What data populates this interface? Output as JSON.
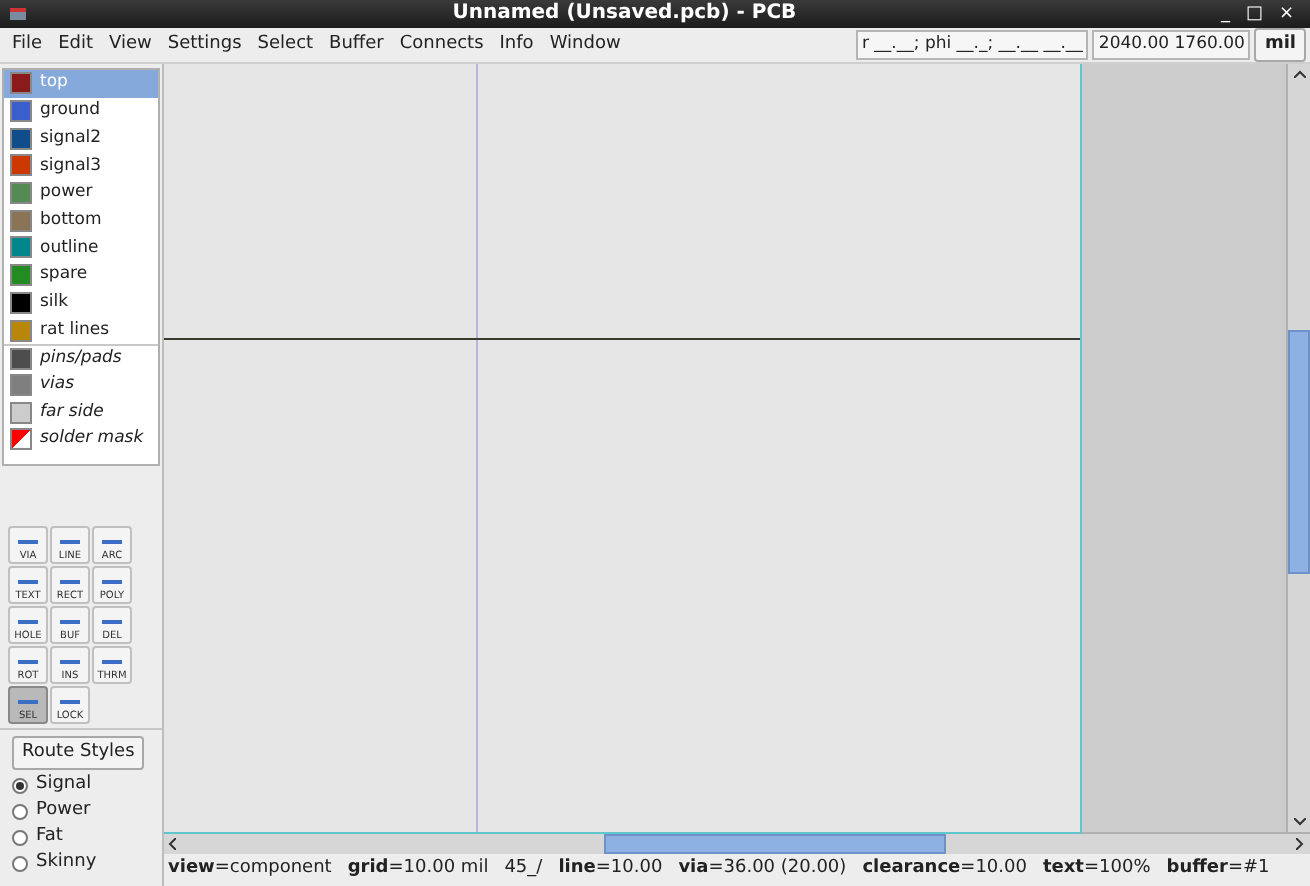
{
  "window": {
    "title": "Unnamed (Unsaved.pcb) - PCB",
    "controls": [
      "_",
      "□",
      "×"
    ]
  },
  "menu": [
    "File",
    "Edit",
    "View",
    "Settings",
    "Select",
    "Buffer",
    "Connects",
    "Info",
    "Window"
  ],
  "coords": {
    "polar": "r __.__; phi __._; __.__ __.__",
    "position": "2040.00 1760.00",
    "unit": "mil"
  },
  "layers": [
    {
      "name": "top",
      "color": "#8b1a1a",
      "selected": true,
      "kind": "layer"
    },
    {
      "name": "ground",
      "color": "#3a5fcd",
      "selected": false,
      "kind": "layer"
    },
    {
      "name": "signal2",
      "color": "#104e8b",
      "selected": false,
      "kind": "layer"
    },
    {
      "name": "signal3",
      "color": "#cd3700",
      "selected": false,
      "kind": "layer"
    },
    {
      "name": "power",
      "color": "#548b54",
      "selected": false,
      "kind": "layer"
    },
    {
      "name": "bottom",
      "color": "#8b7355",
      "selected": false,
      "kind": "layer"
    },
    {
      "name": "outline",
      "color": "#00868b",
      "selected": false,
      "kind": "layer"
    },
    {
      "name": "spare",
      "color": "#228b22",
      "selected": false,
      "kind": "layer"
    },
    {
      "name": "silk",
      "color": "#000000",
      "selected": false,
      "kind": "layer"
    },
    {
      "name": "rat lines",
      "color": "#b8860b",
      "selected": false,
      "kind": "layer"
    },
    {
      "name": "pins/pads",
      "color": "#4d4d4d",
      "selected": false,
      "kind": "virtual"
    },
    {
      "name": "vias",
      "color": "#7f7f7f",
      "selected": false,
      "kind": "virtual"
    },
    {
      "name": "far side",
      "color": "#cccccc",
      "selected": false,
      "kind": "virtual"
    },
    {
      "name": "solder mask",
      "color": "#ff0000",
      "selected": false,
      "kind": "mask"
    }
  ],
  "tools": [
    {
      "label": "VIA",
      "selected": false
    },
    {
      "label": "LINE",
      "selected": false
    },
    {
      "label": "ARC",
      "selected": false
    },
    {
      "label": "TEXT",
      "selected": false
    },
    {
      "label": "RECT",
      "selected": false
    },
    {
      "label": "POLY",
      "selected": false
    },
    {
      "label": "HOLE",
      "selected": false
    },
    {
      "label": "BUF",
      "selected": false
    },
    {
      "label": "DEL",
      "selected": false
    },
    {
      "label": "ROT",
      "selected": false
    },
    {
      "label": "INS",
      "selected": false
    },
    {
      "label": "THRM",
      "selected": false
    },
    {
      "label": "SEL",
      "selected": true
    },
    {
      "label": "LOCK",
      "selected": false
    }
  ],
  "route_styles": {
    "button": "Route Styles",
    "options": [
      {
        "label": "Signal",
        "selected": true
      },
      {
        "label": "Power",
        "selected": false
      },
      {
        "label": "Fat",
        "selected": false
      },
      {
        "label": "Skinny",
        "selected": false
      }
    ]
  },
  "status_bar": [
    "**view**=component",
    "**grid**=10.00 mil",
    "45_/",
    "**line**=10.00",
    "**via**=36.00 (20.00)",
    "**clearance**=10.00",
    "**text**=100%",
    "**buffer**=#1"
  ]
}
